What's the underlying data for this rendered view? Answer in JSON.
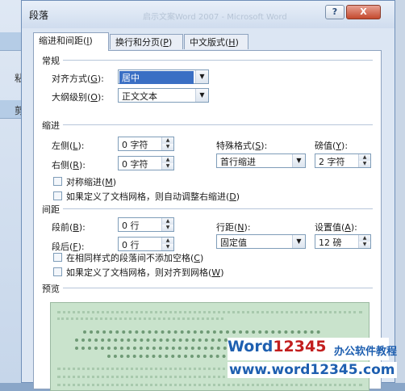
{
  "background": {
    "left_char": "粘",
    "left_char2": "剪"
  },
  "dialog": {
    "title": "段落",
    "blurred_title": "启示文案Word 2007 - Microsoft Word",
    "help_label": "?",
    "close_label": "X"
  },
  "tabs": [
    {
      "label": "缩进和间距(",
      "key": "I",
      "end": ")"
    },
    {
      "label": "换行和分页(",
      "key": "P",
      "end": ")"
    },
    {
      "label": "中文版式(",
      "key": "H",
      "end": ")"
    }
  ],
  "general": {
    "heading": "常规",
    "alignment_label": "对齐方式(",
    "alignment_key": "G",
    "alignment_end": "):",
    "alignment_value": "居中",
    "outline_label": "大纲级别(",
    "outline_key": "O",
    "outline_end": "):",
    "outline_value": "正文文本"
  },
  "indent": {
    "heading": "缩进",
    "left_label": "左侧(",
    "left_key": "L",
    "left_end": "):",
    "left_value": "0 字符",
    "right_label": "右侧(",
    "right_key": "R",
    "right_end": "):",
    "right_value": "0 字符",
    "special_label": "特殊格式(",
    "special_key": "S",
    "special_end": "):",
    "special_value": "首行缩进",
    "by_label": "磅值(",
    "by_key": "Y",
    "by_end": "):",
    "by_value": "2 字符",
    "mirror_label": "对称缩进(",
    "mirror_key": "M",
    "mirror_end": ")",
    "grid_label": "如果定义了文档网格，则自动调整右缩进(",
    "grid_key": "D",
    "grid_end": ")"
  },
  "spacing": {
    "heading": "间距",
    "before_label": "段前(",
    "before_key": "B",
    "before_end": "):",
    "before_value": "0 行",
    "after_label": "段后(",
    "after_key": "F",
    "after_end": "):",
    "after_value": "0 行",
    "line_label": "行距(",
    "line_key": "N",
    "line_end": "):",
    "line_value": "固定值",
    "at_label": "设置值(",
    "at_key": "A",
    "at_end": "):",
    "at_value": "12 磅",
    "no_space_label": "在相同样式的段落间不添加空格(",
    "no_space_key": "C",
    "no_space_end": ")",
    "snap_label": "如果定义了文档网格，则对齐到网格(",
    "snap_key": "W",
    "snap_end": ")"
  },
  "preview": {
    "heading": "预览"
  },
  "watermark": {
    "logo_word": "Word",
    "logo_num": "12345",
    "cn": "办公软件教程",
    "url": "www.word12345.com"
  },
  "colors": {
    "selection": "#3a6fc4",
    "preview_bg": "#c9e3cc",
    "watermark_blue": "#1e5fb0"
  }
}
